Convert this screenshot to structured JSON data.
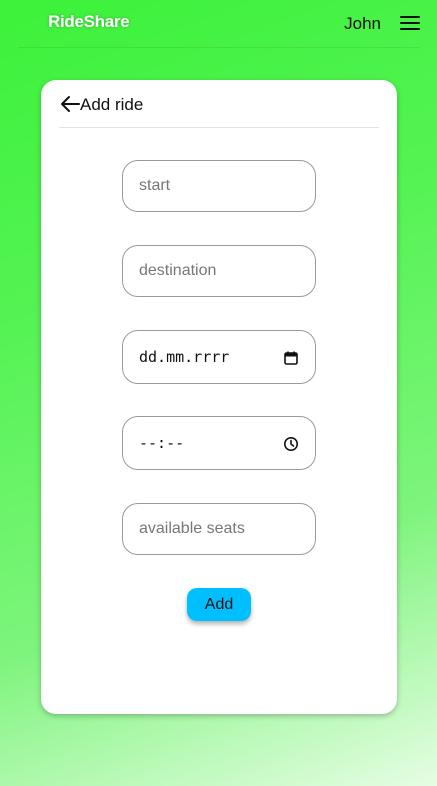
{
  "app": {
    "brand": "RideShare",
    "username": "John",
    "menu_icon": "hamburger-menu-icon"
  },
  "form": {
    "back_icon": "arrow-left-icon",
    "title": "Add ride",
    "start_placeholder": "start",
    "destination_placeholder": "destination",
    "date_value": "dd.mm.rrrr",
    "date_icon": "calendar-icon",
    "time_value": "--:--",
    "time_icon": "clock-icon",
    "seats_placeholder": "available seats",
    "submit_label": "Add"
  },
  "colors": {
    "button_accent": "#00bfff",
    "background_start": "#3cf23a",
    "background_end": "#e6fde4"
  }
}
